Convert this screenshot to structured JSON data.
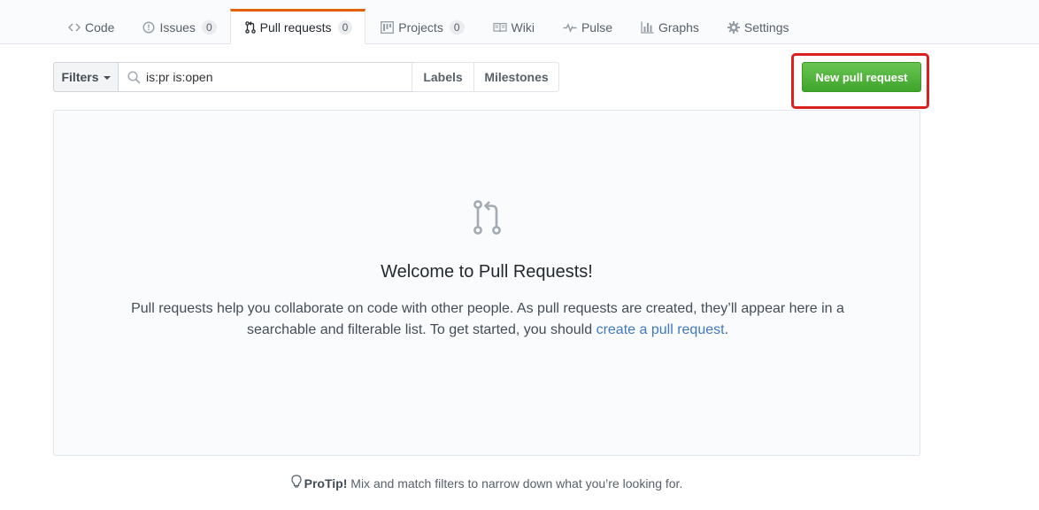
{
  "reponav": {
    "tabs": [
      {
        "label": "Code",
        "icon": "code-icon",
        "counter": null
      },
      {
        "label": "Issues",
        "icon": "issue-opened-icon",
        "counter": "0"
      },
      {
        "label": "Pull requests",
        "icon": "git-pull-request-icon",
        "counter": "0",
        "selected": true
      },
      {
        "label": "Projects",
        "icon": "project-icon",
        "counter": "0"
      },
      {
        "label": "Wiki",
        "icon": "book-icon",
        "counter": null
      },
      {
        "label": "Pulse",
        "icon": "pulse-icon",
        "counter": null
      },
      {
        "label": "Graphs",
        "icon": "graph-icon",
        "counter": null
      },
      {
        "label": "Settings",
        "icon": "gear-icon",
        "counter": null
      }
    ]
  },
  "subnav": {
    "filters_label": "Filters",
    "search_value": "is:pr is:open",
    "labels_label": "Labels",
    "milestones_label": "Milestones"
  },
  "new_pr_label": "New pull request",
  "blankslate": {
    "title": "Welcome to Pull Requests!",
    "text_before": "Pull requests help you collaborate on code with other people. As pull requests are created, they’ll appear here in a searchable and filterable list. To get started, you should ",
    "link": "create a pull request",
    "text_after": "."
  },
  "protip": {
    "label": "ProTip!",
    "text": " Mix and match filters to narrow down what you’re looking for."
  },
  "colors": {
    "accent_tab": "#e36209",
    "new_pr_green": "#3ea52b",
    "highlight_red": "#d9211f",
    "link_blue": "#4078c0"
  }
}
